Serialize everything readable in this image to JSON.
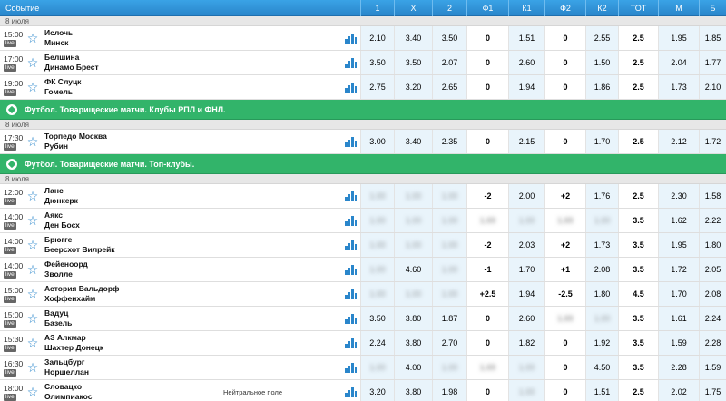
{
  "header": {
    "columns": [
      "Событие",
      "1",
      "X",
      "2",
      "Ф1",
      "К1",
      "Ф2",
      "К2",
      "ТОТ",
      "М",
      "Б"
    ]
  },
  "sections": [
    {
      "type": "date",
      "label": "8 июля"
    },
    {
      "type": "match",
      "time": "15:00",
      "live": "live",
      "team1": "Ислочь",
      "team2": "Минск",
      "note": "",
      "odds": [
        "2.10",
        "3.40",
        "3.50",
        "0",
        "1.51",
        "0",
        "2.55",
        "2.5",
        "1.95",
        "1.85"
      ],
      "blur": []
    },
    {
      "type": "match",
      "time": "17:00",
      "live": "live",
      "team1": "Белшина",
      "team2": "Динамо Брест",
      "note": "",
      "odds": [
        "3.50",
        "3.50",
        "2.07",
        "0",
        "2.60",
        "0",
        "1.50",
        "2.5",
        "2.04",
        "1.77"
      ],
      "blur": []
    },
    {
      "type": "match",
      "time": "19:00",
      "live": "live",
      "team1": "ФК Слуцк",
      "team2": "Гомель",
      "note": "",
      "odds": [
        "2.75",
        "3.20",
        "2.65",
        "0",
        "1.94",
        "0",
        "1.86",
        "2.5",
        "1.73",
        "2.10"
      ],
      "blur": []
    },
    {
      "type": "league",
      "label": "Футбол. Товарищеские матчи. Клубы РПЛ и ФНЛ."
    },
    {
      "type": "date",
      "label": "8 июля"
    },
    {
      "type": "match",
      "time": "17:30",
      "live": "live",
      "team1": "Торпедо Москва",
      "team2": "Рубин",
      "note": "",
      "odds": [
        "3.00",
        "3.40",
        "2.35",
        "0",
        "2.15",
        "0",
        "1.70",
        "2.5",
        "2.12",
        "1.72"
      ],
      "blur": []
    },
    {
      "type": "league",
      "label": "Футбол. Товарищеские матчи. Топ-клубы."
    },
    {
      "type": "date",
      "label": "8 июля"
    },
    {
      "type": "match",
      "time": "12:00",
      "live": "live",
      "team1": "Ланс",
      "team2": "Дюнкерк",
      "note": "",
      "odds": [
        "",
        "",
        "",
        "-2",
        "2.00",
        "+2",
        "1.76",
        "2.5",
        "2.30",
        "1.58"
      ],
      "blur": [
        0,
        1,
        2
      ]
    },
    {
      "type": "match",
      "time": "14:00",
      "live": "live",
      "team1": "Аякс",
      "team2": "Ден Босх",
      "note": "",
      "odds": [
        "",
        "",
        "",
        "",
        "",
        "",
        "",
        "3.5",
        "1.62",
        "2.22"
      ],
      "blur": [
        0,
        1,
        2,
        3,
        4,
        5,
        6
      ]
    },
    {
      "type": "match",
      "time": "14:00",
      "live": "live",
      "team1": "Брюгге",
      "team2": "Беерсхот Вилрейк",
      "note": "",
      "odds": [
        "",
        "",
        "",
        "-2",
        "2.03",
        "+2",
        "1.73",
        "3.5",
        "1.95",
        "1.80"
      ],
      "blur": [
        0,
        1,
        2
      ]
    },
    {
      "type": "match",
      "time": "14:00",
      "live": "live",
      "team1": "Фейеноорд",
      "team2": "Зволле",
      "note": "",
      "odds": [
        "",
        "4.60",
        "",
        "-1",
        "1.70",
        "+1",
        "2.08",
        "3.5",
        "1.72",
        "2.05"
      ],
      "blur": [
        0,
        2
      ]
    },
    {
      "type": "match",
      "time": "15:00",
      "live": "live",
      "team1": "Астория Вальдорф",
      "team2": "Хоффенхайм",
      "note": "",
      "odds": [
        "",
        "",
        "",
        "+2.5",
        "1.94",
        "-2.5",
        "1.80",
        "4.5",
        "1.70",
        "2.08"
      ],
      "blur": [
        0,
        1,
        2
      ]
    },
    {
      "type": "match",
      "time": "15:00",
      "live": "live",
      "team1": "Вадуц",
      "team2": "Базель",
      "note": "",
      "odds": [
        "3.50",
        "3.80",
        "1.87",
        "0",
        "2.60",
        "",
        "",
        "3.5",
        "1.61",
        "2.24"
      ],
      "blur": [
        5,
        6
      ]
    },
    {
      "type": "match",
      "time": "15:30",
      "live": "live",
      "team1": "АЗ Алкмар",
      "team2": "Шахтер Донецк",
      "note": "",
      "odds": [
        "2.24",
        "3.80",
        "2.70",
        "0",
        "1.82",
        "0",
        "1.92",
        "3.5",
        "1.59",
        "2.28"
      ],
      "blur": []
    },
    {
      "type": "match",
      "time": "16:30",
      "live": "live",
      "team1": "Зальцбург",
      "team2": "Норшеллан",
      "note": "",
      "odds": [
        "",
        "4.00",
        "",
        "",
        "",
        "0",
        "4.50",
        "3.5",
        "2.28",
        "1.59"
      ],
      "blur": [
        0,
        2,
        3,
        4
      ]
    },
    {
      "type": "match",
      "time": "18:00",
      "live": "live",
      "team1": "Словацко",
      "team2": "Олимпиакос",
      "note": "Нейтральное поле",
      "odds": [
        "3.20",
        "3.80",
        "1.98",
        "0",
        "",
        "0",
        "1.51",
        "2.5",
        "2.02",
        "1.75"
      ],
      "blur": [
        4
      ]
    }
  ],
  "colors": {
    "header": "#2a86cb",
    "league": "#32b46a",
    "odd_cell": "#e9f4fb",
    "icon": "#2a86cb"
  }
}
